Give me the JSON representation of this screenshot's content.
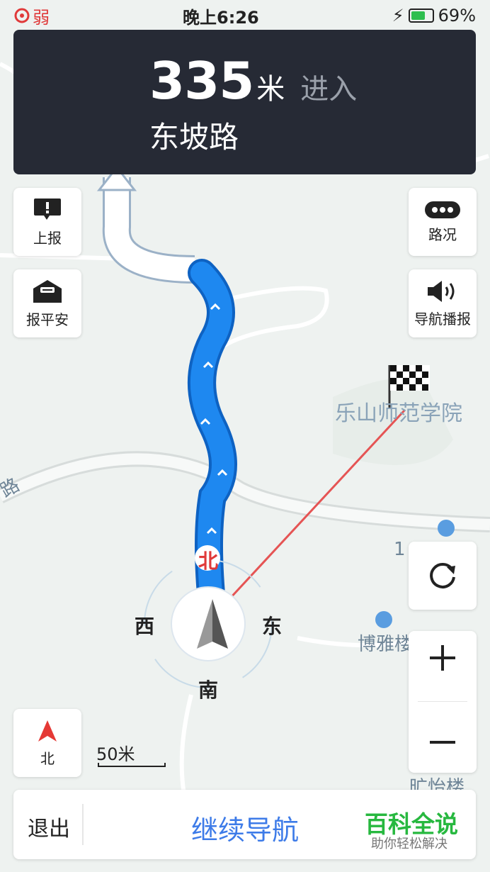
{
  "status_bar": {
    "signal": "弱",
    "time": "晚上6:26",
    "battery": "69%",
    "battery_level": 0.69
  },
  "guidance": {
    "distance": "335",
    "unit": "米",
    "action": "进入",
    "road": "东坡路"
  },
  "buttons": {
    "report": "上报",
    "safe": "报平安",
    "traffic": "路况",
    "voice": "导航播报",
    "north": "北"
  },
  "compass": {
    "north": "北",
    "west": "西",
    "east": "东",
    "south": "南"
  },
  "map_labels": {
    "destination": "乐山师范学院",
    "poi1": "1",
    "poi2": "博雅楼",
    "poi3": "旷怡楼",
    "road_fragment": "路"
  },
  "scale": "50米",
  "bottom": {
    "exit": "退出",
    "continue": "继续导航",
    "brand": "百科全说",
    "brand_sub": "助你轻松解决"
  },
  "colors": {
    "route": "#1e88f0",
    "card": "#262a35",
    "accent": "#3d7be8",
    "brand": "#27b83f"
  }
}
